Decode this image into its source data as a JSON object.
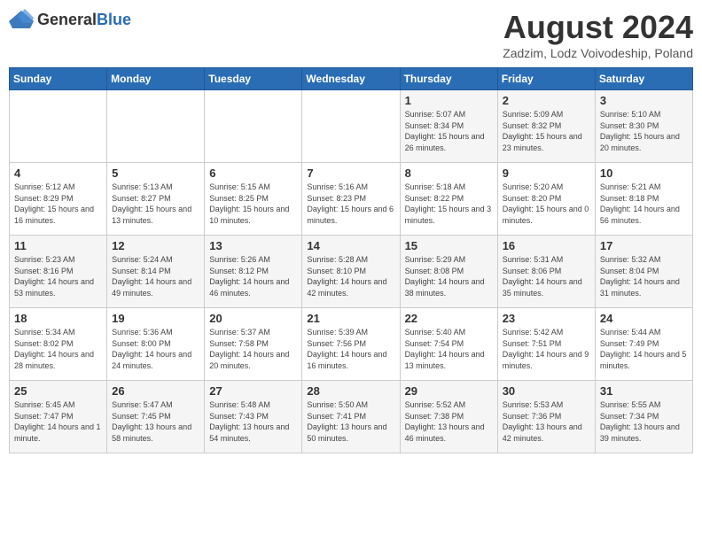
{
  "header": {
    "logo_general": "General",
    "logo_blue": "Blue",
    "month": "August 2024",
    "location": "Zadzim, Lodz Voivodeship, Poland"
  },
  "days_of_week": [
    "Sunday",
    "Monday",
    "Tuesday",
    "Wednesday",
    "Thursday",
    "Friday",
    "Saturday"
  ],
  "weeks": [
    [
      {
        "day": "",
        "sunrise": "",
        "sunset": "",
        "daylight": ""
      },
      {
        "day": "",
        "sunrise": "",
        "sunset": "",
        "daylight": ""
      },
      {
        "day": "",
        "sunrise": "",
        "sunset": "",
        "daylight": ""
      },
      {
        "day": "",
        "sunrise": "",
        "sunset": "",
        "daylight": ""
      },
      {
        "day": "1",
        "sunrise": "5:07 AM",
        "sunset": "8:34 PM",
        "daylight": "15 hours and 26 minutes."
      },
      {
        "day": "2",
        "sunrise": "5:09 AM",
        "sunset": "8:32 PM",
        "daylight": "15 hours and 23 minutes."
      },
      {
        "day": "3",
        "sunrise": "5:10 AM",
        "sunset": "8:30 PM",
        "daylight": "15 hours and 20 minutes."
      }
    ],
    [
      {
        "day": "4",
        "sunrise": "5:12 AM",
        "sunset": "8:29 PM",
        "daylight": "15 hours and 16 minutes."
      },
      {
        "day": "5",
        "sunrise": "5:13 AM",
        "sunset": "8:27 PM",
        "daylight": "15 hours and 13 minutes."
      },
      {
        "day": "6",
        "sunrise": "5:15 AM",
        "sunset": "8:25 PM",
        "daylight": "15 hours and 10 minutes."
      },
      {
        "day": "7",
        "sunrise": "5:16 AM",
        "sunset": "8:23 PM",
        "daylight": "15 hours and 6 minutes."
      },
      {
        "day": "8",
        "sunrise": "5:18 AM",
        "sunset": "8:22 PM",
        "daylight": "15 hours and 3 minutes."
      },
      {
        "day": "9",
        "sunrise": "5:20 AM",
        "sunset": "8:20 PM",
        "daylight": "15 hours and 0 minutes."
      },
      {
        "day": "10",
        "sunrise": "5:21 AM",
        "sunset": "8:18 PM",
        "daylight": "14 hours and 56 minutes."
      }
    ],
    [
      {
        "day": "11",
        "sunrise": "5:23 AM",
        "sunset": "8:16 PM",
        "daylight": "14 hours and 53 minutes."
      },
      {
        "day": "12",
        "sunrise": "5:24 AM",
        "sunset": "8:14 PM",
        "daylight": "14 hours and 49 minutes."
      },
      {
        "day": "13",
        "sunrise": "5:26 AM",
        "sunset": "8:12 PM",
        "daylight": "14 hours and 46 minutes."
      },
      {
        "day": "14",
        "sunrise": "5:28 AM",
        "sunset": "8:10 PM",
        "daylight": "14 hours and 42 minutes."
      },
      {
        "day": "15",
        "sunrise": "5:29 AM",
        "sunset": "8:08 PM",
        "daylight": "14 hours and 38 minutes."
      },
      {
        "day": "16",
        "sunrise": "5:31 AM",
        "sunset": "8:06 PM",
        "daylight": "14 hours and 35 minutes."
      },
      {
        "day": "17",
        "sunrise": "5:32 AM",
        "sunset": "8:04 PM",
        "daylight": "14 hours and 31 minutes."
      }
    ],
    [
      {
        "day": "18",
        "sunrise": "5:34 AM",
        "sunset": "8:02 PM",
        "daylight": "14 hours and 28 minutes."
      },
      {
        "day": "19",
        "sunrise": "5:36 AM",
        "sunset": "8:00 PM",
        "daylight": "14 hours and 24 minutes."
      },
      {
        "day": "20",
        "sunrise": "5:37 AM",
        "sunset": "7:58 PM",
        "daylight": "14 hours and 20 minutes."
      },
      {
        "day": "21",
        "sunrise": "5:39 AM",
        "sunset": "7:56 PM",
        "daylight": "14 hours and 16 minutes."
      },
      {
        "day": "22",
        "sunrise": "5:40 AM",
        "sunset": "7:54 PM",
        "daylight": "14 hours and 13 minutes."
      },
      {
        "day": "23",
        "sunrise": "5:42 AM",
        "sunset": "7:51 PM",
        "daylight": "14 hours and 9 minutes."
      },
      {
        "day": "24",
        "sunrise": "5:44 AM",
        "sunset": "7:49 PM",
        "daylight": "14 hours and 5 minutes."
      }
    ],
    [
      {
        "day": "25",
        "sunrise": "5:45 AM",
        "sunset": "7:47 PM",
        "daylight": "14 hours and 1 minute."
      },
      {
        "day": "26",
        "sunrise": "5:47 AM",
        "sunset": "7:45 PM",
        "daylight": "13 hours and 58 minutes."
      },
      {
        "day": "27",
        "sunrise": "5:48 AM",
        "sunset": "7:43 PM",
        "daylight": "13 hours and 54 minutes."
      },
      {
        "day": "28",
        "sunrise": "5:50 AM",
        "sunset": "7:41 PM",
        "daylight": "13 hours and 50 minutes."
      },
      {
        "day": "29",
        "sunrise": "5:52 AM",
        "sunset": "7:38 PM",
        "daylight": "13 hours and 46 minutes."
      },
      {
        "day": "30",
        "sunrise": "5:53 AM",
        "sunset": "7:36 PM",
        "daylight": "13 hours and 42 minutes."
      },
      {
        "day": "31",
        "sunrise": "5:55 AM",
        "sunset": "7:34 PM",
        "daylight": "13 hours and 39 minutes."
      }
    ]
  ]
}
